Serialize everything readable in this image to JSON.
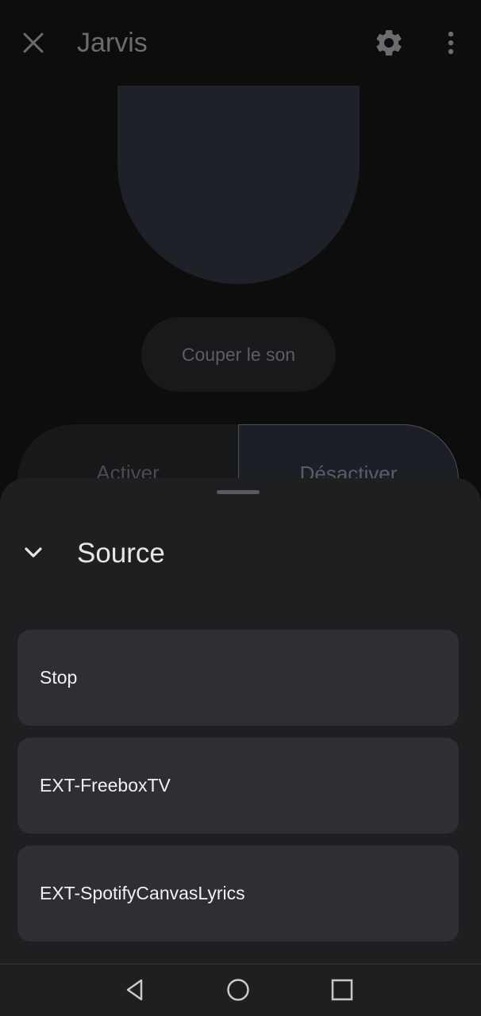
{
  "header": {
    "title": "Jarvis",
    "close_icon": "close-icon",
    "settings_icon": "gear-icon",
    "more_icon": "more-vert-icon"
  },
  "controls": {
    "mute_label": "Couper le son",
    "activate_label": "Activer",
    "deactivate_label": "Désactiver"
  },
  "sheet": {
    "title": "Source",
    "collapse_icon": "chevron-down-icon",
    "options": [
      {
        "label": "Stop"
      },
      {
        "label": "EXT-FreeboxTV"
      },
      {
        "label": "EXT-SpotifyCanvasLyrics"
      }
    ]
  },
  "navbar": {
    "back_icon": "back-triangle-icon",
    "home_icon": "home-circle-icon",
    "recents_icon": "recents-square-icon"
  },
  "colors": {
    "background": "#0d0d0e",
    "sheet": "#1f1f21",
    "option": "#2d2f34",
    "accent_dim": "#1e2128"
  }
}
